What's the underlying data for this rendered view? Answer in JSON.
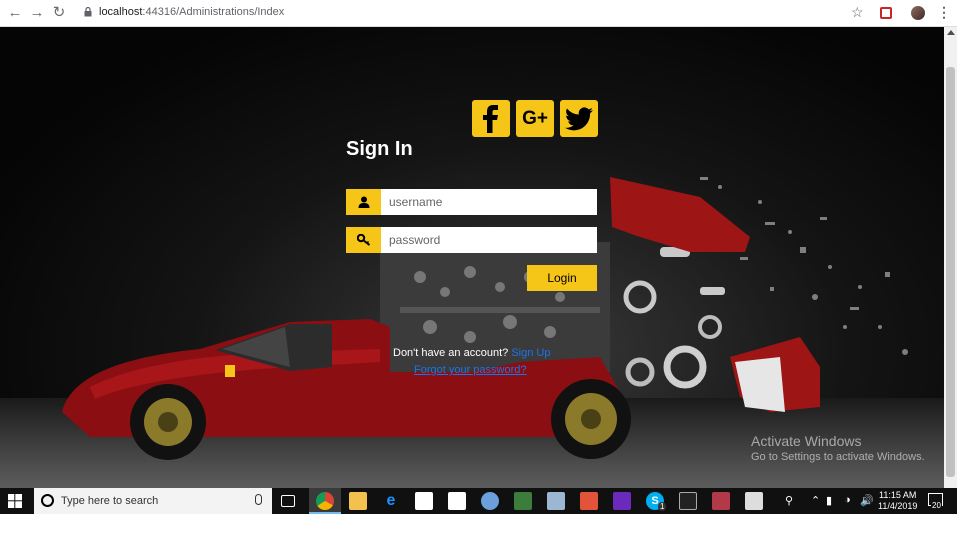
{
  "browser": {
    "url_host": "localhost",
    "url_path": ":44316/Administrations/Index"
  },
  "social": {
    "facebook_icon": "facebook-icon",
    "google_plus_label": "G+",
    "twitter_icon": "twitter-icon"
  },
  "form": {
    "title": "Sign In",
    "username_placeholder": "username",
    "password_placeholder": "password",
    "login_label": "Login",
    "no_account_text": "Don't have an account?",
    "signup_label": "Sign Up",
    "forgot_label": "Forgot your password?"
  },
  "watermark": {
    "line1": "Activate Windows",
    "line2": "Go to Settings to activate Windows."
  },
  "taskbar": {
    "search_placeholder": "Type here to search",
    "time": "11:15 AM",
    "date": "11/4/2019",
    "notification_count": "20",
    "skype_badge": "1"
  },
  "colors": {
    "accent": "#f5c518",
    "link": "#1e73e8"
  }
}
